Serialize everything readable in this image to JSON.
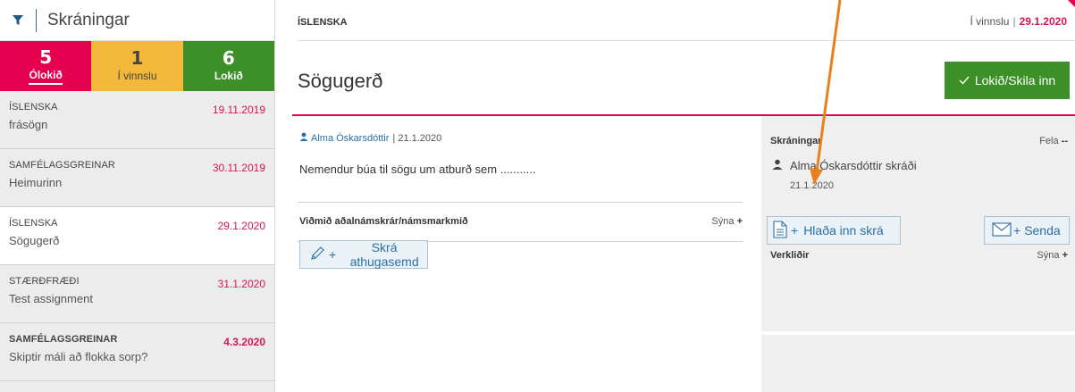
{
  "sidebar": {
    "title": "Skráningar",
    "status": {
      "open": {
        "count": "5",
        "label": "Ólokið"
      },
      "in_progress": {
        "count": "1",
        "label": "Í vinnslu"
      },
      "done": {
        "count": "6",
        "label": "Lokið"
      }
    },
    "items": [
      {
        "subject": "ÍSLENSKA",
        "name": "frásögn",
        "date": "19.11.2019"
      },
      {
        "subject": "SAMFÉLAGSGREINAR",
        "name": "Heimurinn",
        "date": "30.11.2019"
      },
      {
        "subject": "ÍSLENSKA",
        "name": "Sögugerð",
        "date": "29.1.2020"
      },
      {
        "subject": "STÆRÐFRÆÐI",
        "name": "Test assignment",
        "date": "31.1.2020"
      },
      {
        "subject": "SAMFÉLAGSGREINAR",
        "name": "Skiptir máli að flokka sorp?",
        "date": "4.3.2020"
      }
    ]
  },
  "topbar": {
    "subject": "ÍSLENSKA",
    "status": "Í vinnslu",
    "separator": "|",
    "date": "29.1.2020"
  },
  "main": {
    "title": "Sögugerð",
    "done_button": "Lokið/Skila inn",
    "author": "Alma Óskarsdóttir",
    "author_sep": "| 21.1.2020",
    "description": "Nemendur búa til sögu um atburð sem ...........",
    "criteria_label": "Viðmið aðalnámskrár/námsmarkmið",
    "show_label": "Sýna",
    "comment_button": "Skrá athugasemd"
  },
  "panel": {
    "title": "Skráningar",
    "hide_label": "Fela",
    "entry_text": "Alma Óskarsdóttir skráði",
    "entry_date": "21.1.2020",
    "upload_button": "Hlaða inn skrá",
    "send_button": "Senda",
    "workparts_label": "Verkliðir",
    "show_label": "Sýna"
  },
  "colors": {
    "accent_red": "#e5004f",
    "accent_yellow": "#f3b83a",
    "accent_green": "#3d8f27",
    "link_blue": "#2a6fa8",
    "annotation_orange": "#e8801e"
  },
  "icons": [
    "filter-icon",
    "person-icon",
    "check-icon",
    "pencil-icon",
    "document-icon",
    "envelope-icon"
  ]
}
